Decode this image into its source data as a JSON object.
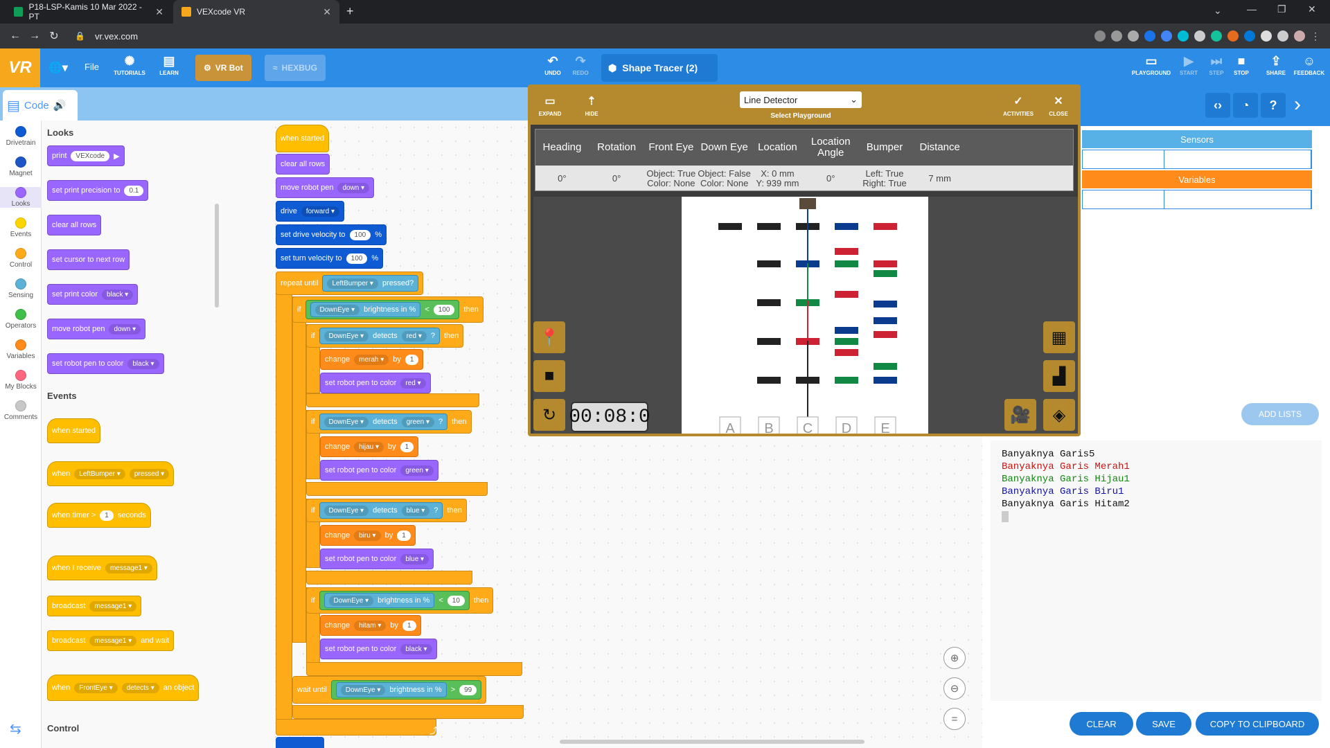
{
  "browser": {
    "tabs": [
      {
        "title": "P18-LSP-Kamis 10 Mar 2022 - PT"
      },
      {
        "title": "VEXcode VR"
      }
    ],
    "url": "vr.vex.com"
  },
  "toolbar": {
    "logo": "VR",
    "file": "File",
    "tutorials": "TUTORIALS",
    "learn": "LEARN",
    "vrbot": "VR Bot",
    "hexbug": "HEXBUG",
    "undo": "UNDO",
    "redo": "REDO",
    "project": "Shape Tracer (2)",
    "playground": "PLAYGROUND",
    "start": "START",
    "step": "STEP",
    "stop": "STOP",
    "share": "SHARE",
    "feedback": "FEEDBACK"
  },
  "codetab": {
    "label": "Code"
  },
  "categories": [
    {
      "label": "Drivetrain",
      "color": "#0f5bd4"
    },
    {
      "label": "Magnet",
      "color": "#1e56c8"
    },
    {
      "label": "Looks",
      "color": "#9966ff"
    },
    {
      "label": "Events",
      "color": "#ffd500"
    },
    {
      "label": "Control",
      "color": "#ffab19"
    },
    {
      "label": "Sensing",
      "color": "#5cb1d6"
    },
    {
      "label": "Operators",
      "color": "#40bf4a"
    },
    {
      "label": "Variables",
      "color": "#ff8c1a"
    },
    {
      "label": "My Blocks",
      "color": "#ff6680"
    },
    {
      "label": "Comments",
      "color": "#c8c8c8"
    }
  ],
  "palette": {
    "looks_head": "Looks",
    "events_head": "Events",
    "control_head": "Control",
    "looks": [
      {
        "a": "print",
        "b": "VEXcode"
      },
      {
        "a": "set print precision to",
        "b": "0.1"
      },
      {
        "a": "clear all rows"
      },
      {
        "a": "set cursor to next row"
      },
      {
        "a": "set print color",
        "b": "black"
      },
      {
        "a": "move robot pen",
        "b": "down"
      },
      {
        "a": "set robot pen to color",
        "b": "black"
      }
    ],
    "events": {
      "e1": "when started",
      "e2a": "when",
      "e2b": "LeftBumper",
      "e2c": "pressed",
      "e3a": "when timer >",
      "e3b": "1",
      "e3c": "seconds",
      "e4a": "when I receive",
      "e4b": "message1",
      "e5a": "broadcast",
      "e5b": "message1",
      "e6a": "broadcast",
      "e6b": "message1",
      "e6c": "and wait",
      "e7a": "when",
      "e7b": "FrontEye",
      "e7c": "detects",
      "e7d": "an object"
    }
  },
  "script": {
    "when_started": "when started",
    "clear": "clear all rows",
    "move_pen": "move robot pen",
    "move_pen_v": "down",
    "drive": "drive",
    "drive_v": "forward",
    "vel": "set drive velocity to",
    "vel_v": "100",
    "turn": "set turn velocity to",
    "turn_v": "100",
    "pct": "%",
    "repeat": "repeat until",
    "left_bumper": "LeftBumper",
    "pressed": "pressed?",
    "if": "if",
    "then": "then",
    "downeye": "DownEye",
    "brightness": "brightness in %",
    "lt": "<",
    "gt": ">",
    "b1": "100",
    "detects": "detects",
    "q": "?",
    "red": "red",
    "green": "green",
    "blue": "blue",
    "change": "change",
    "by": "by",
    "one": "1",
    "merah": "merah",
    "hijau": "hijau",
    "biru": "biru",
    "hitam": "hitam",
    "penc": "set robot pen to color",
    "black": "black",
    "b2": "10",
    "wait": "wait until",
    "b3": "99"
  },
  "playground": {
    "expand": "EXPAND",
    "hide": "HIDE",
    "select_value": "Line Detector",
    "select_label": "Select Playground",
    "activities": "ACTIVITIES",
    "close": "CLOSE",
    "headers": [
      "Heading",
      "Rotation",
      "Front Eye",
      "Down Eye",
      "Location",
      "Location Angle",
      "Bumper",
      "Distance"
    ],
    "values": [
      "0°",
      "0°",
      "Object: True\nColor: None",
      "Object: False\nColor: None",
      "X: 0 mm\nY: 939 mm",
      "0°",
      "Left: True\nRight: True",
      "7 mm"
    ],
    "columns": [
      "A",
      "B",
      "C",
      "D",
      "E"
    ],
    "timer": "00:08:0"
  },
  "monitor": {
    "sensors": "Sensors",
    "variables": "Variables",
    "add_lists": "ADD LISTS"
  },
  "console": {
    "lines": [
      {
        "t": "Banyaknya Garis5",
        "c": "#111111"
      },
      {
        "t": "Banyaknya Garis Merah1",
        "c": "#cc1111"
      },
      {
        "t": "Banyaknya Garis Hijau1",
        "c": "#118811"
      },
      {
        "t": "Banyaknya Garis Biru1",
        "c": "#1111aa"
      },
      {
        "t": "Banyaknya Garis Hitam2",
        "c": "#111111"
      }
    ],
    "clear": "CLEAR",
    "save": "SAVE",
    "copy": "COPY TO CLIPBOARD"
  }
}
